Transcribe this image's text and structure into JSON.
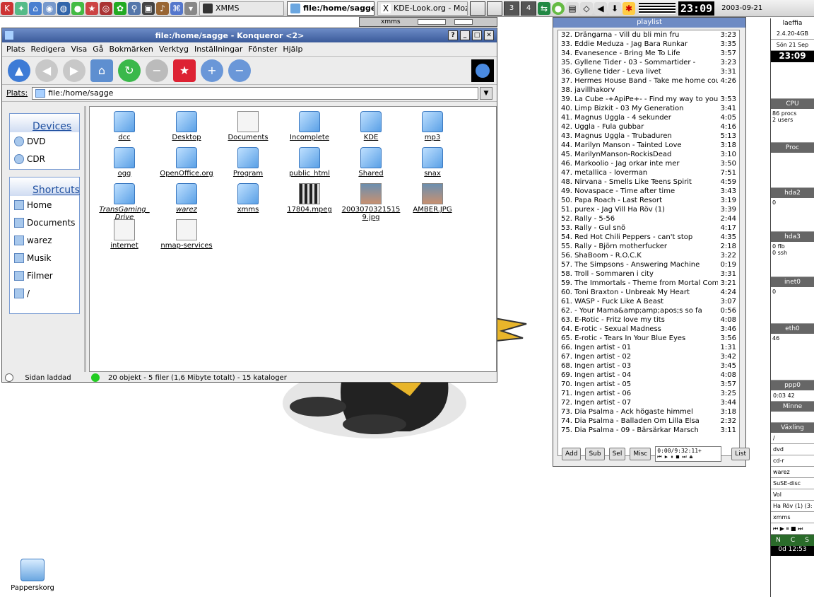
{
  "taskbar": {
    "tasks": [
      "XMMS",
      "file:/home/sagge",
      "KDE-Look.org - Mozi"
    ],
    "pager": [
      "3",
      "4"
    ],
    "clock": "23:09",
    "date": "2003-09-21"
  },
  "xmms": {
    "title": "xmms"
  },
  "konqueror": {
    "title": "file:/home/sagge - Konqueror <2>",
    "menu": [
      "Plats",
      "Redigera",
      "Visa",
      "Gå",
      "Bokmärken",
      "Verktyg",
      "Inställningar",
      "Fönster",
      "Hjälp"
    ],
    "location_label": "Plats:",
    "location": "file:/home/sagge",
    "devices_title": "Devices",
    "devices": [
      "DVD",
      "CDR"
    ],
    "shortcuts_title": "Shortcuts",
    "shortcuts": [
      "Home",
      "Documents",
      "warez",
      "Musik",
      "Filmer",
      "/"
    ],
    "files": [
      {
        "name": "dcc",
        "kind": "folder"
      },
      {
        "name": "Desktop",
        "kind": "folder"
      },
      {
        "name": "Documents",
        "kind": "doc"
      },
      {
        "name": "Incomplete",
        "kind": "folder"
      },
      {
        "name": "KDE",
        "kind": "folder"
      },
      {
        "name": "mp3",
        "kind": "folder"
      },
      {
        "name": "ogg",
        "kind": "folder"
      },
      {
        "name": "OpenOffice.org",
        "kind": "folder"
      },
      {
        "name": "Program",
        "kind": "folder"
      },
      {
        "name": "public_html",
        "kind": "folder"
      },
      {
        "name": "Shared",
        "kind": "folder"
      },
      {
        "name": "snax",
        "kind": "folder"
      },
      {
        "name": "TransGaming_ Drive",
        "kind": "folder"
      },
      {
        "name": "warez",
        "kind": "folder"
      },
      {
        "name": "xmms",
        "kind": "folder"
      },
      {
        "name": "17804.mpeg",
        "kind": "video"
      },
      {
        "name": "2003070321515 9.jpg",
        "kind": "image"
      },
      {
        "name": "AMBER.JPG",
        "kind": "image"
      },
      {
        "name": "internet",
        "kind": "doc"
      },
      {
        "name": "nmap-services",
        "kind": "doc"
      }
    ],
    "status_left": "Sidan laddad",
    "status": "20 objekt - 5 filer (1,6 Mibyte totalt) - 15 kataloger"
  },
  "playlist": {
    "title": "playlist",
    "items": [
      {
        "t": "32. Drängarna - Vill du bli min fru",
        "d": "3:23"
      },
      {
        "t": "33. Eddie Meduza - Jag Bara Runkar",
        "d": "3:35"
      },
      {
        "t": "34. Evanesence - Bring Me To Life",
        "d": "3:57"
      },
      {
        "t": "35. Gyllene Tider - 03 - Sommartider -",
        "d": "3:23"
      },
      {
        "t": "36. Gyllene tider - Leva livet",
        "d": "3:31"
      },
      {
        "t": "37. Hermes House Band - Take me home cou...",
        "d": "4:26"
      },
      {
        "t": "38. javillhakorv",
        "d": ""
      },
      {
        "t": "39. La Cube -+ApiPe+- - Find my way to you",
        "d": "3:53"
      },
      {
        "t": "40. Limp Bizkit - 03 My Generation",
        "d": "3:41"
      },
      {
        "t": "41. Magnus Uggla - 4 sekunder",
        "d": "4:05"
      },
      {
        "t": "42. Uggla - Fula gubbar",
        "d": "4:16"
      },
      {
        "t": "43. Magnus Uggla - Trubaduren",
        "d": "5:13"
      },
      {
        "t": "44. Marilyn Manson - Tainted Love",
        "d": "3:18"
      },
      {
        "t": "45. MarilynManson-RockisDead",
        "d": "3:10"
      },
      {
        "t": "46. Markoolio - Jag orkar inte mer",
        "d": "3:50"
      },
      {
        "t": "47. metallica - loverman",
        "d": "7:51"
      },
      {
        "t": "48. Nirvana - Smells Like Teens Spirit",
        "d": "4:59"
      },
      {
        "t": "49. Novaspace - Time after time",
        "d": "3:43"
      },
      {
        "t": "50. Papa Roach - Last Resort",
        "d": "3:19"
      },
      {
        "t": "51. purex - Jag Vill Ha Röv (1)",
        "d": "3:39"
      },
      {
        "t": "52. Rally - 5-56",
        "d": "2:44"
      },
      {
        "t": "53. Rally - Gul snö",
        "d": "4:17"
      },
      {
        "t": "54. Red Hot Chili Peppers - can't stop",
        "d": "4:35"
      },
      {
        "t": "55. Rally - Björn motherfucker",
        "d": "2:18"
      },
      {
        "t": "56. ShaBoom - R.O.C.K",
        "d": "3:22"
      },
      {
        "t": "57. The Simpsons - Answering Machine",
        "d": "0:19"
      },
      {
        "t": "58. Troll - Sommaren i city",
        "d": "3:31"
      },
      {
        "t": "59. The Immortals - Theme from Mortal Com...",
        "d": "3:21"
      },
      {
        "t": "60. Toni Braxton - Unbreak My Heart",
        "d": "4:24"
      },
      {
        "t": "61. WASP - Fuck Like A Beast",
        "d": "3:07"
      },
      {
        "t": "62. - Your Mama&amp;amp;apos;s so fa",
        "d": "0:56"
      },
      {
        "t": "63. E-Rotic - Fritz love my tits",
        "d": "4:08"
      },
      {
        "t": "64. E-rotic - Sexual Madness",
        "d": "3:46"
      },
      {
        "t": "65. E-rotic - Tears In Your Blue Eyes",
        "d": "3:56"
      },
      {
        "t": "66. Ingen artist - 01",
        "d": "1:31"
      },
      {
        "t": "67. Ingen artist - 02",
        "d": "3:42"
      },
      {
        "t": "68. Ingen artist - 03",
        "d": "3:45"
      },
      {
        "t": "69. Ingen artist - 04",
        "d": "4:08"
      },
      {
        "t": "70. Ingen artist - 05",
        "d": "3:57"
      },
      {
        "t": "71. Ingen artist - 06",
        "d": "3:25"
      },
      {
        "t": "72. Ingen artist - 07",
        "d": "3:44"
      },
      {
        "t": "73. Dia Psalma - Ack högaste himmel",
        "d": "3:18"
      },
      {
        "t": "74. Dia Psalma - Balladen Om Lilla Elsa",
        "d": "2:32"
      },
      {
        "t": "75. Dia Psalma - 09 - Bärsärkar Marsch",
        "d": "3:11"
      }
    ],
    "buttons": [
      "Add",
      "Sub",
      "Sel",
      "Misc"
    ],
    "time": "0:00/9:32:11+",
    "list_button": "List"
  },
  "gkrellm": {
    "host": "laeffia",
    "kernel": "2.4.20-4GB",
    "date": "Sön 21 Sep",
    "time": "23:09",
    "sections": [
      "CPU",
      "Proc",
      "hda2",
      "hda3",
      "inet0",
      "eth0",
      "ppp0",
      "Minne",
      "Växling"
    ],
    "cpu_procs": "86 procs",
    "cpu_users": "2 users",
    "hda2_val": "0",
    "hda3_lines": [
      "0 flb",
      "0 ssh"
    ],
    "inet0_val": "0",
    "eth0_val": "46",
    "ppp0_val": "0:03 42",
    "mounts": [
      "/",
      "dvd",
      "cd-r",
      "warez",
      "SuSE-disc"
    ],
    "vol": "Vol",
    "song": "Ha Röv (1) (3:",
    "xmms_lbl": "xmms",
    "uptime": "0d 12:53"
  },
  "desktop": {
    "trash": "Papperskorg"
  }
}
